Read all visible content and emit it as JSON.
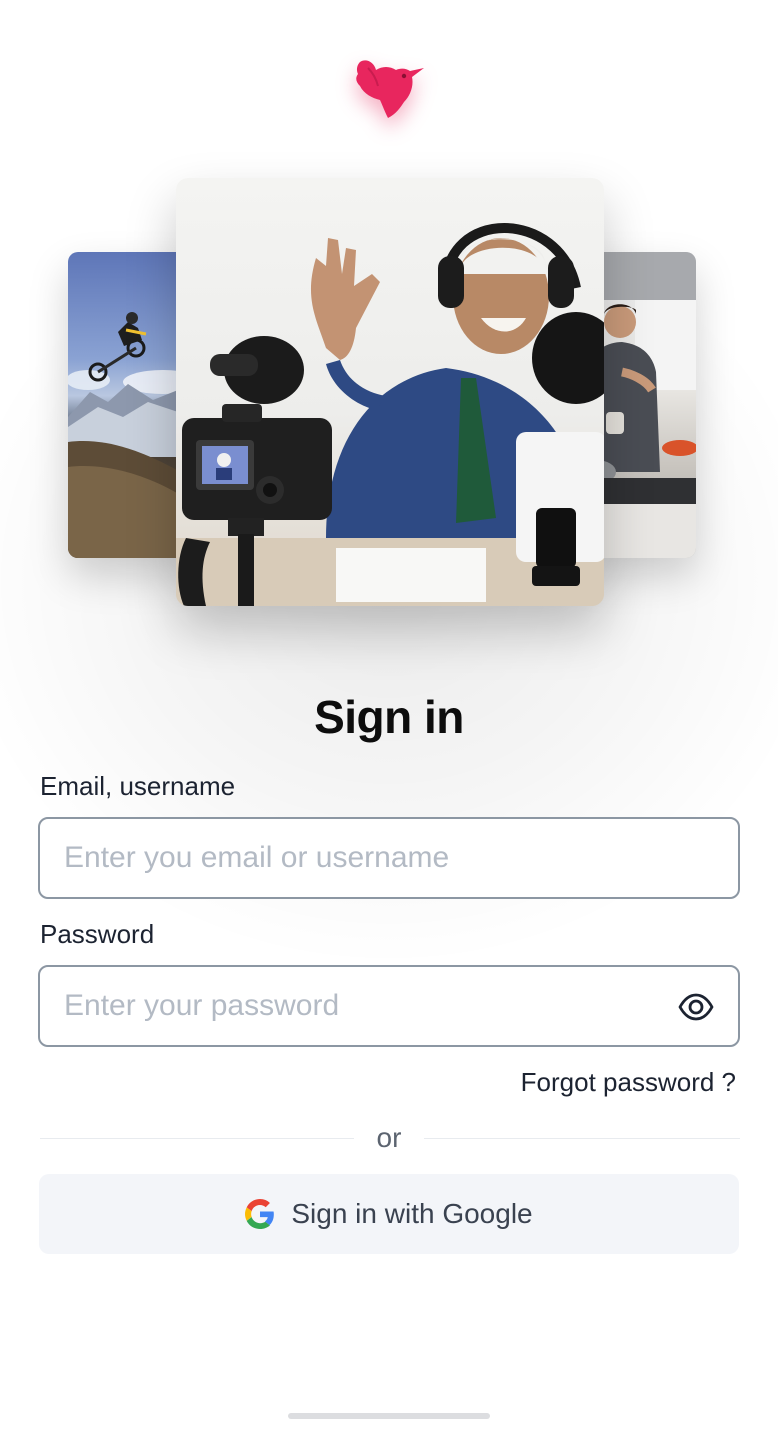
{
  "brand": {
    "logo_icon": "hummingbird-logo-icon",
    "accent_color": "#e8265e"
  },
  "hero": {
    "photos": [
      {
        "name": "mountain-bike-jump-photo"
      },
      {
        "name": "vlogger-waving-photo"
      },
      {
        "name": "kitchen-cooking-photo"
      }
    ]
  },
  "form": {
    "title": "Sign in",
    "email": {
      "label": "Email, username",
      "placeholder": "Enter you email or username",
      "value": ""
    },
    "password": {
      "label": "Password",
      "placeholder": "Enter your password",
      "value": "",
      "toggle_icon": "eye-icon"
    },
    "forgot_password": "Forgot password ?",
    "divider_text": "or",
    "google_button": {
      "label": "Sign in with Google",
      "icon": "google-icon"
    }
  },
  "colors": {
    "text_primary": "#0d0d0d",
    "field_border": "#8c97a3",
    "placeholder": "#b3bac4",
    "google_button_bg": "#f3f5f9"
  }
}
